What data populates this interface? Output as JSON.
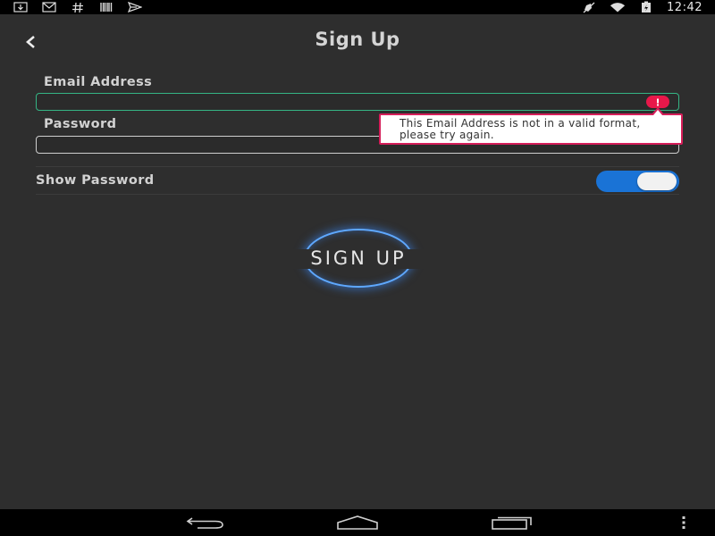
{
  "status_bar": {
    "icons_left": [
      "download-icon",
      "gmail-icon",
      "hash-icon",
      "barcode-icon",
      "send-icon"
    ],
    "icons_right": [
      "mute-icon",
      "wifi-icon",
      "battery-charging-icon"
    ],
    "time": "12:42"
  },
  "header": {
    "title": "Sign Up",
    "back_icon": "chevron-left-icon"
  },
  "form": {
    "email_label": "Email Address",
    "email_value": "",
    "password_label": "Password",
    "password_value": "",
    "error_message": "This Email Address is not in a valid format, please try again.",
    "show_password_label": "Show Password",
    "show_password_enabled": true
  },
  "signup_button": {
    "label": "SIGN UP"
  },
  "nav_bar": {
    "icons": [
      "back-icon",
      "home-icon",
      "recent-apps-icon",
      "overflow-menu-icon"
    ]
  },
  "colors": {
    "background": "#2e2e2e",
    "accent_blue": "#1a73d6",
    "error_red": "#e8184a",
    "email_border_green": "#35b585",
    "glow_blue": "#5ea8ff"
  }
}
